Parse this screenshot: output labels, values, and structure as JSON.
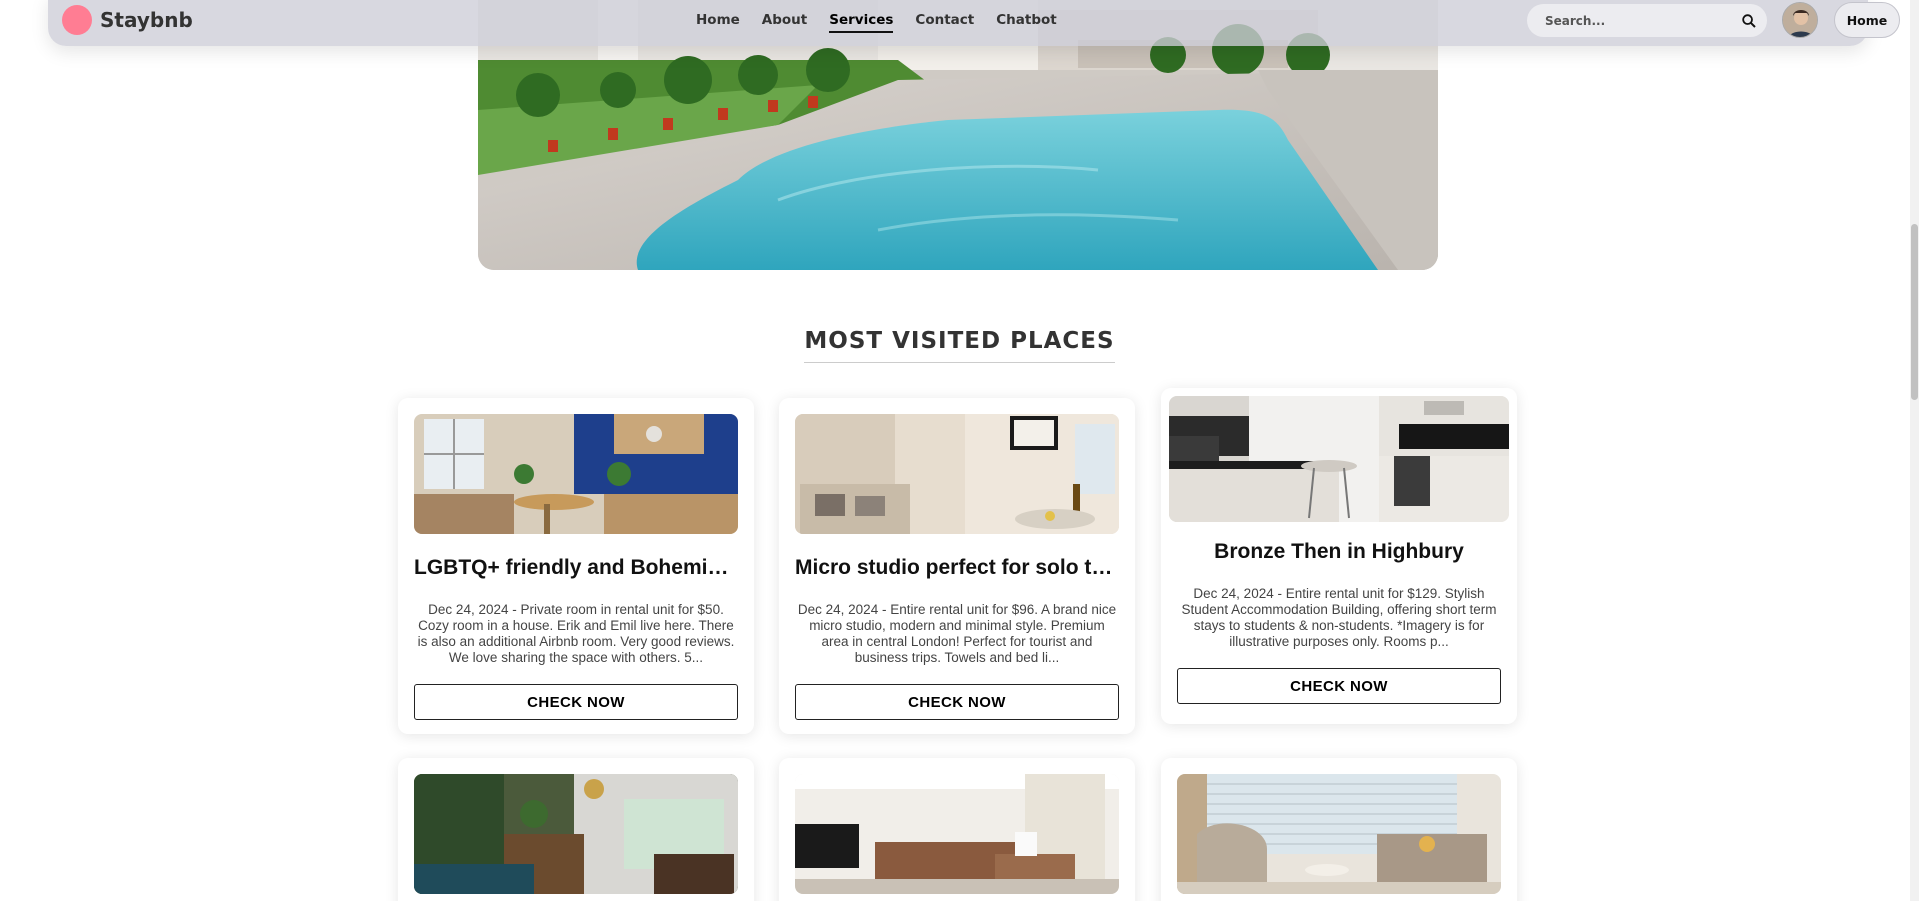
{
  "brand": {
    "name": "Staybnb",
    "color": "#ff7d93"
  },
  "nav": {
    "links": [
      {
        "label": "Home",
        "active": false
      },
      {
        "label": "About",
        "active": false
      },
      {
        "label": "Services",
        "active": true
      },
      {
        "label": "Contact",
        "active": false
      },
      {
        "label": "Chatbot",
        "active": false
      }
    ],
    "search_placeholder": "Search...",
    "search_icon": "search-icon",
    "home_button": "Home"
  },
  "section": {
    "title": "MOST VISITED PLACES"
  },
  "cards": [
    {
      "title": "LGBTQ+ friendly and Bohemian Room in Central London",
      "description": "Dec 24, 2024 - Private room in rental unit for $50. Cozy room in a house. Erik and Emil live here. There is also an additional Airbnb room. Very good reviews. We love sharing the space with others. 5...",
      "button": "CHECK NOW"
    },
    {
      "title": "Micro studio perfect for solo travellers",
      "description": "Dec 24, 2024 - Entire rental unit for $96. A brand nice micro studio, modern and minimal style. Premium area in central London! Perfect for tourist and business trips. Towels and bed li...",
      "button": "CHECK NOW"
    },
    {
      "title": "Bronze Then in Highbury",
      "description": "Dec 24, 2024 - Entire rental unit for $129. Stylish Student Accommodation Building, offering short term stays to students & non-students. *Imagery is for illustrative purposes only. Rooms p...",
      "button": "CHECK NOW"
    }
  ],
  "colors": {
    "accent": "#ff7d93",
    "pool": "#3fb3c6",
    "wall_blue": "#1e3f8c"
  }
}
